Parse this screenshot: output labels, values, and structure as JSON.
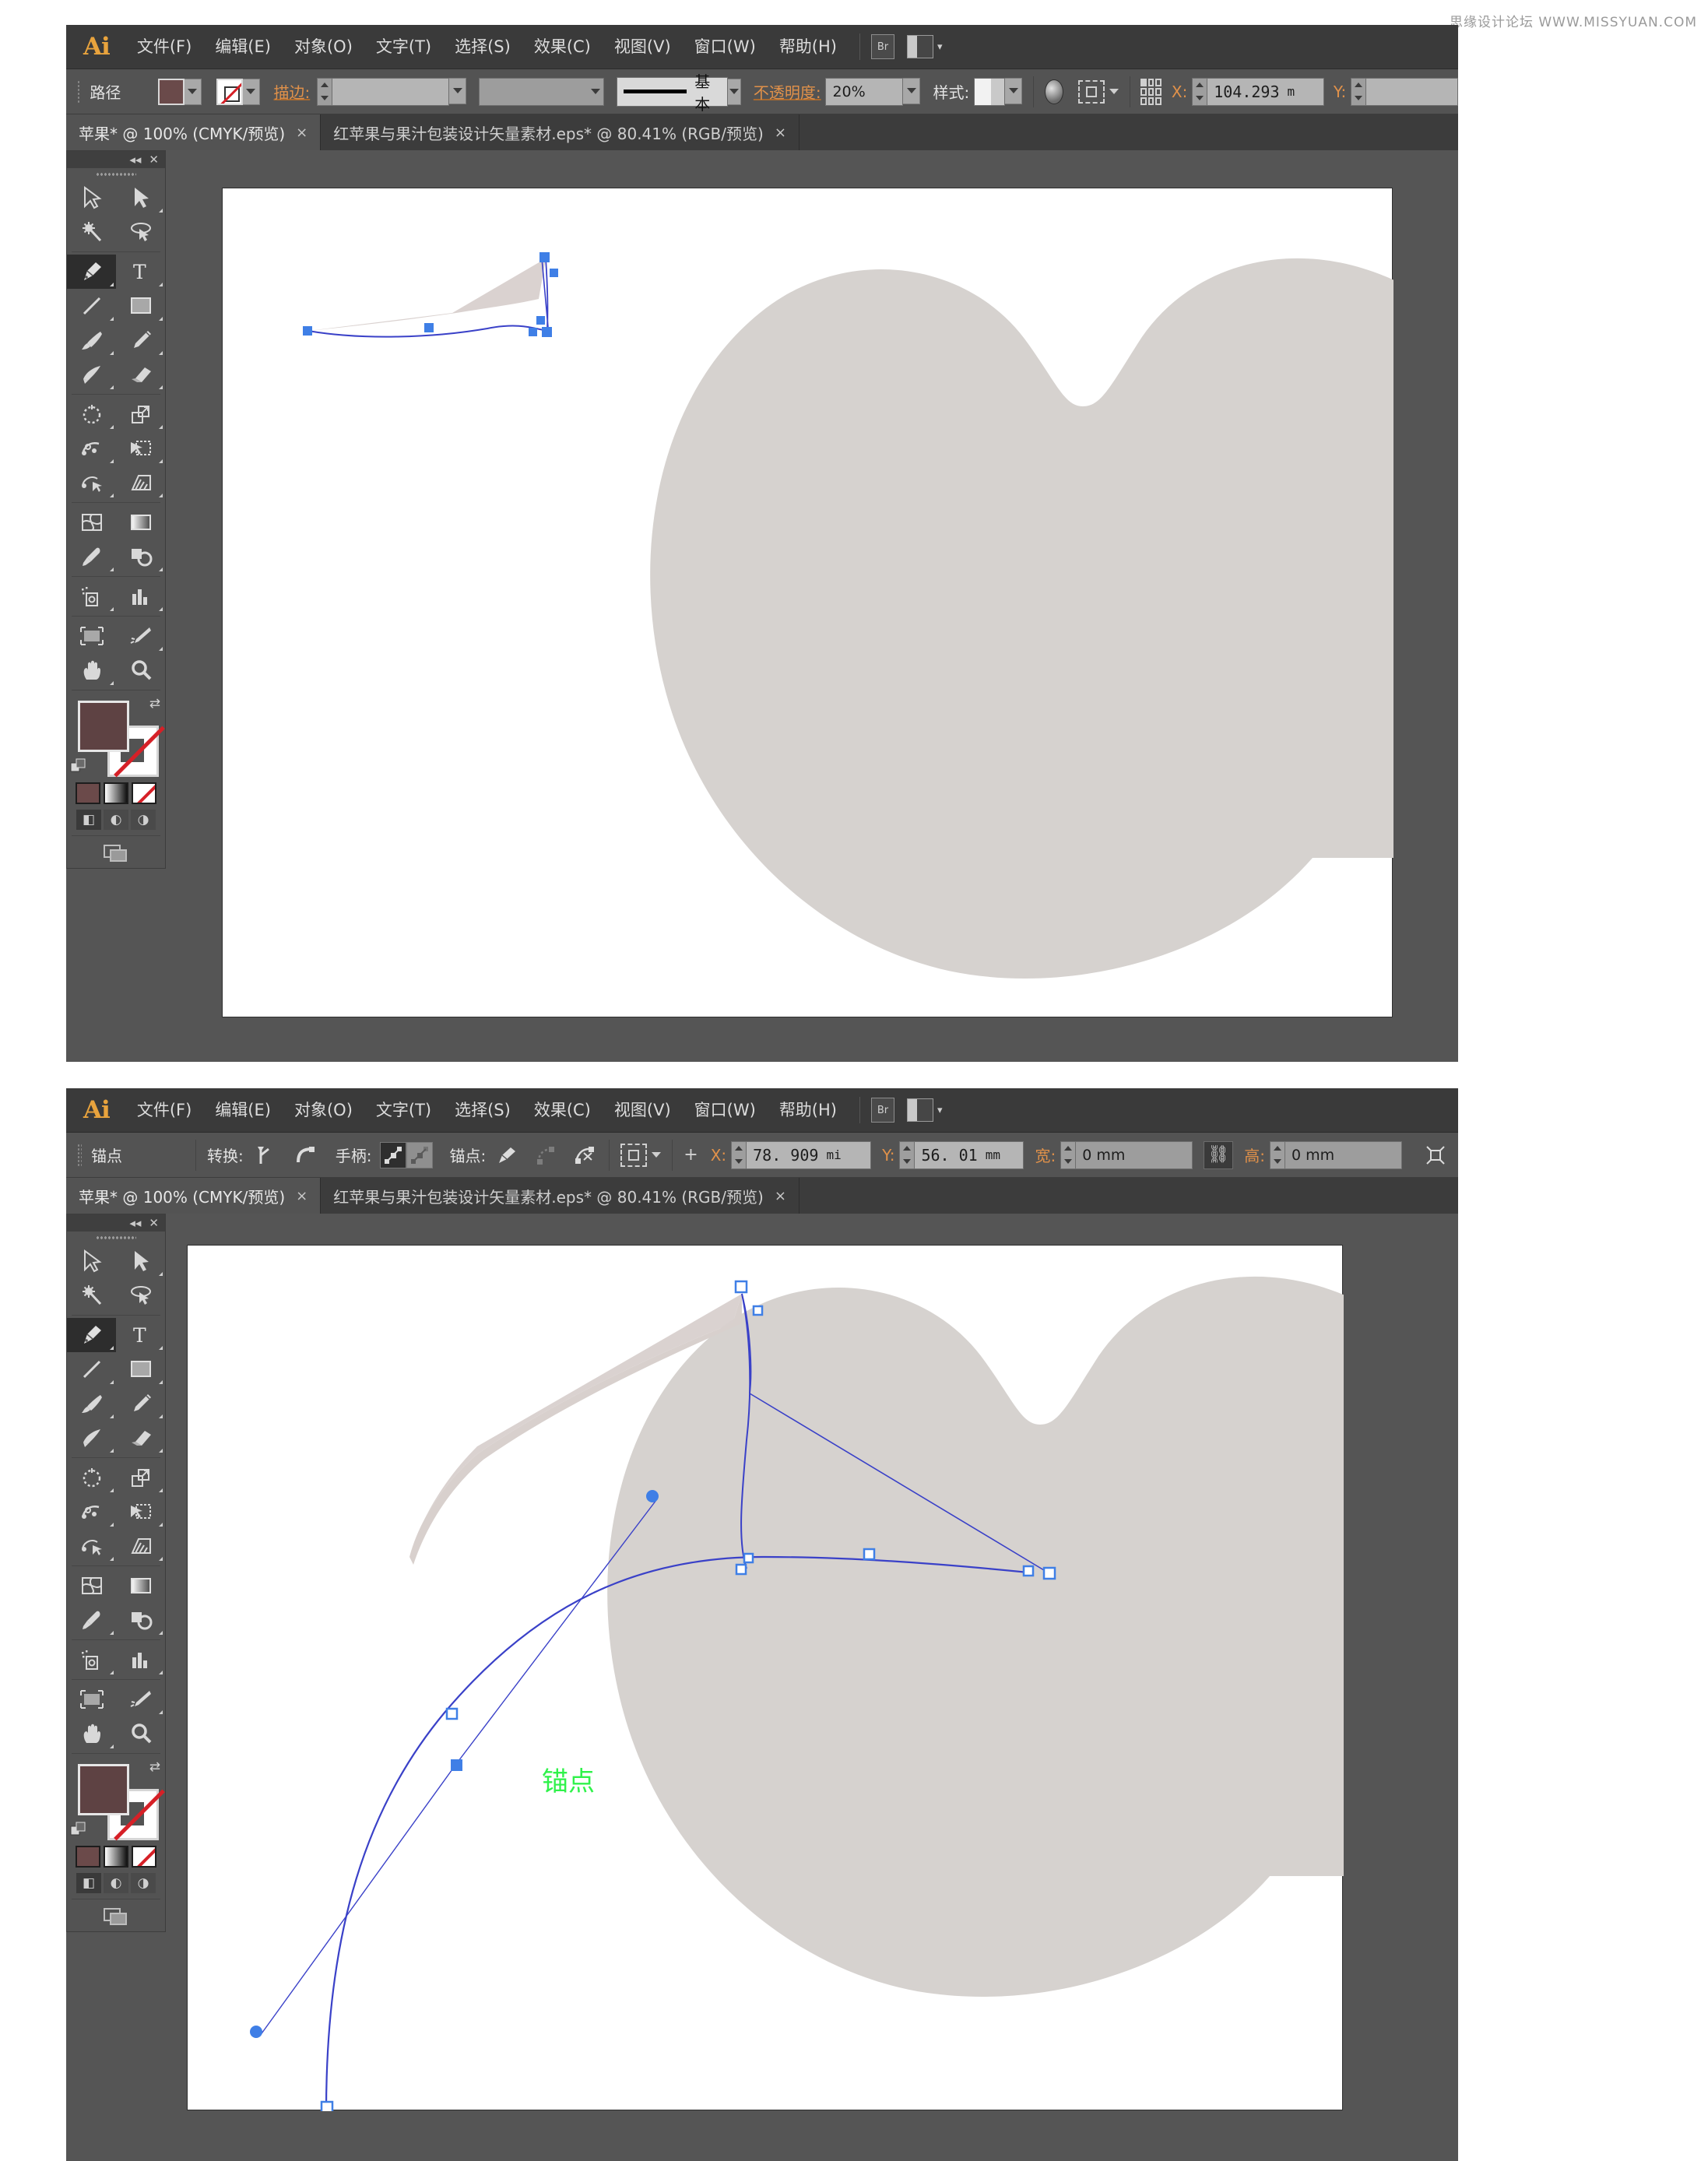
{
  "watermark": "思缘设计论坛 WWW.MISSYUAN.COM",
  "app": {
    "logo": "Ai"
  },
  "menubar": {
    "items": [
      {
        "label": "文件(F)"
      },
      {
        "label": "编辑(E)"
      },
      {
        "label": "对象(O)"
      },
      {
        "label": "文字(T)"
      },
      {
        "label": "选择(S)"
      },
      {
        "label": "效果(C)"
      },
      {
        "label": "视图(V)"
      },
      {
        "label": "窗口(W)"
      },
      {
        "label": "帮助(H)"
      }
    ],
    "bridge_label": "Br",
    "arrange_icon": "arrange-documents-icon"
  },
  "window1": {
    "controlbar": {
      "context_label": "路径",
      "fill_color": "#6a4a4a",
      "stroke_color": "无",
      "stroke_label": "描边:",
      "stroke_weight": "",
      "stroke_profile": "",
      "brush_definition_label": "基本",
      "opacity_label": "不透明度:",
      "opacity_value": "20%",
      "style_label": "样式:",
      "x_label": "X:",
      "x_value": "104.293",
      "x_unit": "m",
      "y_label": "Y:",
      "y_value": ""
    },
    "tabs": [
      {
        "label": "苹果* @ 100% (CMYK/预览)",
        "active": true,
        "close": "×"
      },
      {
        "label": "红苹果与果汁包装设计矢量素材.eps* @ 80.41% (RGB/预览)",
        "active": false,
        "close": "×"
      }
    ]
  },
  "window2": {
    "controlbar": {
      "context_label": "锚点",
      "convert_label": "转换:",
      "handles_label": "手柄:",
      "anchors_label": "锚点:",
      "x_label": "X:",
      "x_value": "78. 909",
      "x_unit": "mi",
      "y_label": "Y:",
      "y_value": "56. 01",
      "y_unit": "mm",
      "width_label": "宽:",
      "width_value": "0 mm",
      "link_icon": "link-constrain-icon",
      "height_label": "高:",
      "height_value": "0 mm",
      "transform_icon": "transform-each-icon"
    },
    "tabs": [
      {
        "label": "苹果* @ 100% (CMYK/预览)",
        "active": true,
        "close": "×"
      },
      {
        "label": "红苹果与果汁包装设计矢量素材.eps* @ 80.41% (RGB/预览)",
        "active": false,
        "close": "×"
      }
    ],
    "smart_guide_label": "锚点"
  },
  "toolpanel": {
    "collapse_icon": "collapse-double-arrow-icon",
    "close_icon": "close-icon",
    "tools": [
      {
        "name": "selection-tool",
        "selected": false
      },
      {
        "name": "direct-selection-tool",
        "selected": false
      },
      {
        "name": "magic-wand-tool",
        "selected": false
      },
      {
        "name": "lasso-tool",
        "selected": false
      },
      {
        "name": "pen-tool",
        "selected": true
      },
      {
        "name": "type-tool",
        "selected": false
      },
      {
        "name": "line-segment-tool",
        "selected": false
      },
      {
        "name": "rectangle-tool",
        "selected": false
      },
      {
        "name": "paintbrush-tool",
        "selected": false
      },
      {
        "name": "pencil-tool",
        "selected": false
      },
      {
        "name": "blob-brush-tool",
        "selected": false
      },
      {
        "name": "eraser-tool",
        "selected": false
      },
      {
        "name": "rotate-tool",
        "selected": false
      },
      {
        "name": "scale-tool",
        "selected": false
      },
      {
        "name": "width-tool",
        "selected": false
      },
      {
        "name": "free-transform-tool",
        "selected": false
      },
      {
        "name": "shape-builder-tool",
        "selected": false
      },
      {
        "name": "perspective-grid-tool",
        "selected": false
      },
      {
        "name": "mesh-tool",
        "selected": false
      },
      {
        "name": "gradient-tool",
        "selected": false
      },
      {
        "name": "eyedropper-tool",
        "selected": false
      },
      {
        "name": "blend-tool",
        "selected": false
      },
      {
        "name": "symbol-sprayer-tool",
        "selected": false
      },
      {
        "name": "column-graph-tool",
        "selected": false
      },
      {
        "name": "artboard-tool",
        "selected": false
      },
      {
        "name": "slice-tool",
        "selected": false
      },
      {
        "name": "hand-tool",
        "selected": false
      },
      {
        "name": "zoom-tool",
        "selected": false
      }
    ],
    "fill_color": "#5e4243",
    "stroke_color": "none",
    "swap_icon": "swap-fill-stroke-icon",
    "default_icon": "default-fill-stroke-icon",
    "color_modes": [
      {
        "name": "color-swatch",
        "color": "#6b4a4a"
      },
      {
        "name": "gradient-swatch",
        "color": "#ffffff"
      },
      {
        "name": "none-swatch",
        "color": "#ffffff"
      }
    ],
    "draw_modes": [
      {
        "name": "draw-normal-icon",
        "active": true
      },
      {
        "name": "draw-behind-icon",
        "active": false
      },
      {
        "name": "draw-inside-icon",
        "active": false
      }
    ],
    "screen_mode_icon": "screen-mode-icon"
  },
  "artwork": {
    "shape_fill": "#d6d2cf",
    "path_stroke": "#3a41c8",
    "anchor_color": "#2b6fe0",
    "apple_shape_name": "apple-silhouette"
  }
}
